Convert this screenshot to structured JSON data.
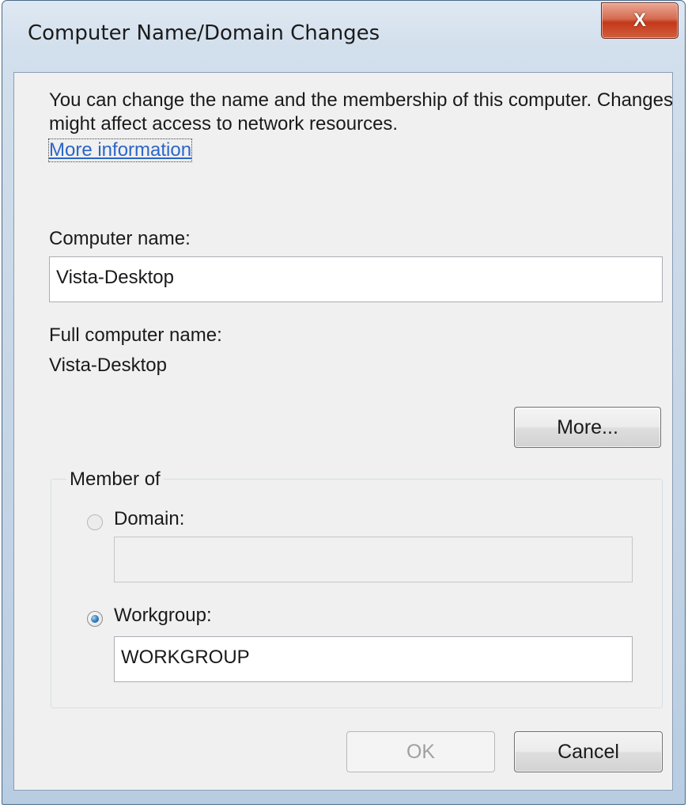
{
  "window": {
    "title": "Computer Name/Domain Changes",
    "close_label": "X"
  },
  "intro": {
    "text": "You can change the name and the membership of this computer. Changes might affect access to network resources.",
    "link": "More information"
  },
  "computer_name": {
    "label": "Computer name:",
    "value": "Vista-Desktop"
  },
  "full_name": {
    "label": "Full computer name:",
    "value": "Vista-Desktop"
  },
  "more_button": "More...",
  "member_of": {
    "title": "Member of",
    "domain": {
      "label": "Domain:",
      "value": "",
      "selected": false
    },
    "workgroup": {
      "label": "Workgroup:",
      "value": "WORKGROUP",
      "selected": true
    }
  },
  "buttons": {
    "ok": "OK",
    "cancel": "Cancel"
  }
}
